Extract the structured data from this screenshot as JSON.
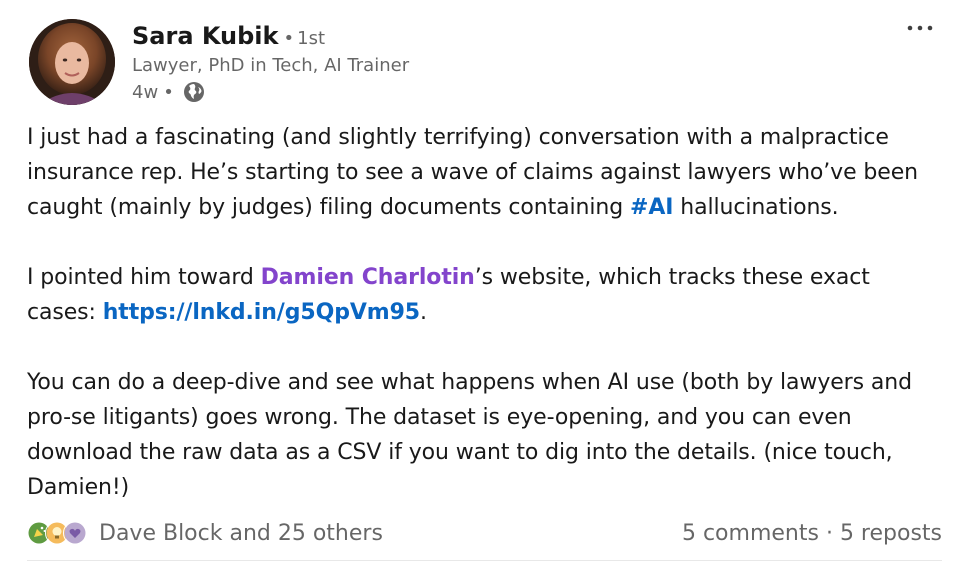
{
  "author": {
    "name": "Sara Kubik",
    "degree": "1st",
    "headline": "Lawyer, PhD in Tech, AI Trainer",
    "time": "4w"
  },
  "icons": {
    "more": "more-horizontal-icon",
    "visibility": "globe-icon",
    "reactions": [
      "celebrate-icon",
      "insightful-icon",
      "love-icon"
    ]
  },
  "body": {
    "p1_a": "I just had a fascinating (and slightly terrifying) conversation with a malpractice insurance rep. He’s starting to see a wave of claims against lawyers who’ve been caught (mainly by judges) filing documents containing ",
    "p1_hashtag": "#AI",
    "p1_b": " hallucinations.",
    "p2_a": "I pointed him toward ",
    "p2_mention": "Damien Charlotin",
    "p2_b": "’s website, which tracks these exact cases: ",
    "p2_link": "https://lnkd.in/g5QpVm95",
    "p2_c": ".",
    "p3": "You can do a deep-dive and see what happens when AI use (both by lawyers and pro-se litigants) goes wrong. The dataset is eye-opening, and you can even download the raw data as a CSV if you want to dig into the details. (nice touch, Damien!)"
  },
  "social": {
    "reactions_label": "Dave Block and 25 others",
    "comments": "5 comments",
    "separator": " · ",
    "reposts": "5 reposts"
  },
  "colors": {
    "link": "#0a66c2",
    "mention": "#8344cc",
    "muted": "rgba(0,0,0,0.6)"
  }
}
